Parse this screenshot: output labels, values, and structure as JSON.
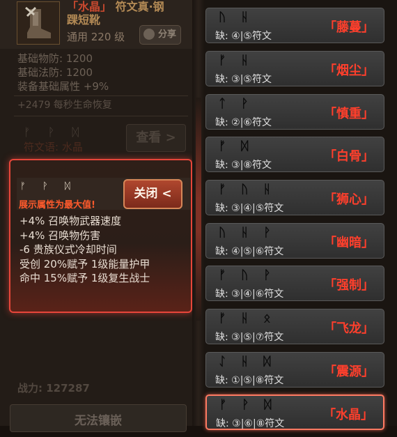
{
  "item": {
    "name": "「水晶」",
    "name_suffix": "符文真·钢",
    "name_line2": "踝短靴",
    "level_text": "通用 220 级",
    "share_label": "分享",
    "stats": [
      "基础物防: 1200",
      "基础法防: 1200",
      "装备基础属性 +9%"
    ],
    "regen": "+2479 每秒生命恢复",
    "runes": "ᚠ ᚹ ᛞ",
    "runeword": "符文语: 水晶",
    "view_label": "查看 >",
    "power": "战力: 127287",
    "bottom_button": "无法镶嵌"
  },
  "popup": {
    "runes": "ᚠ ᚹ ᛞ",
    "hint": "展示属性为最大值!",
    "close_label": "关闭 <",
    "lines": [
      "+4% 召唤物武器速度",
      "+4% 召唤物伤害",
      "-6 贵族仪式冷却时间",
      "受创 20%赋予 1级能量护甲",
      "命中 15%赋予 1级复生战士"
    ]
  },
  "runewords": [
    {
      "runes": "ᚢ ᚺ",
      "missing": "缺: ④|⑤符文",
      "name": "「藤蔓」",
      "selected": false
    },
    {
      "runes": "ᚠ ᚺ",
      "missing": "缺: ③|⑤符文",
      "name": "「烟尘」",
      "selected": false
    },
    {
      "runes": "ᛏ ᚹ",
      "missing": "缺: ②|⑥符文",
      "name": "「慎重」",
      "selected": false
    },
    {
      "runes": "ᚠ ᛞ",
      "missing": "缺: ③|⑧符文",
      "name": "「白骨」",
      "selected": false
    },
    {
      "runes": "ᚠ ᚢ ᚺ",
      "missing": "缺: ③|④|⑤符文",
      "name": "「狮心」",
      "selected": false
    },
    {
      "runes": "ᚢ ᚺ ᚹ",
      "missing": "缺: ④|⑤|⑥符文",
      "name": "「幽暗」",
      "selected": false
    },
    {
      "runes": "ᚠ ᚢ ᚹ",
      "missing": "缺: ③|④|⑥符文",
      "name": "「强制」",
      "selected": false
    },
    {
      "runes": "ᚠ ᚺ ᛟ",
      "missing": "缺: ③|⑤|⑦符文",
      "name": "「飞龙」",
      "selected": false
    },
    {
      "runes": "ᛇ ᚺ ᛞ",
      "missing": "缺: ①|⑤|⑧符文",
      "name": "「震源」",
      "selected": false
    },
    {
      "runes": "ᚠ ᚹ ᛞ",
      "missing": "缺: ③|⑥|⑧符文",
      "name": "「水晶」",
      "selected": true
    }
  ]
}
